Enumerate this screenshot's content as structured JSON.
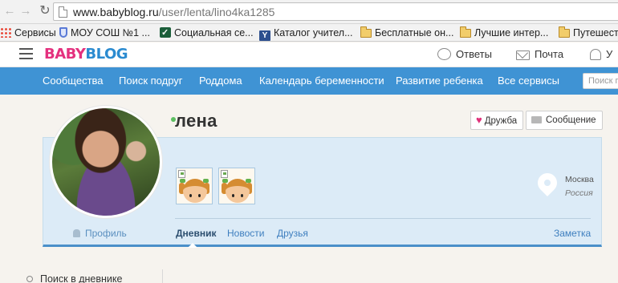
{
  "browser": {
    "url_host": "www.babyblog.ru",
    "url_path": "/user/lenta/lino4ka1285",
    "bookmarks": [
      {
        "icon": "apps-icon",
        "label": "Сервисы"
      },
      {
        "icon": "shield-icon",
        "label": "МОУ СОШ №1 ..."
      },
      {
        "icon": "check-icon",
        "label": "Социальная се..."
      },
      {
        "icon": "yandex-icon",
        "label": "Каталог учител..."
      },
      {
        "icon": "folder-icon",
        "label": "Бесплатные он..."
      },
      {
        "icon": "folder-icon",
        "label": "Лучшие интер..."
      },
      {
        "icon": "folder-icon",
        "label": "Путешест"
      }
    ]
  },
  "header": {
    "logo_baby": "BABY",
    "logo_blog": "BLOG",
    "answers": "Ответы",
    "mail": "Почта",
    "notifications_partial": "У"
  },
  "nav": {
    "items": [
      "Сообщества",
      "Поиск подруг",
      "Роддома",
      "Календарь беременности",
      "Развитие ребенка",
      "Все сервисы"
    ],
    "search_placeholder": "Поиск п"
  },
  "profile": {
    "name": "лена",
    "friend_button": "Дружба",
    "message_button": "Сообщение",
    "city": "Москва",
    "country": "Россия",
    "profile_link": "Профиль",
    "tabs": [
      "Дневник",
      "Новости",
      "Друзья"
    ],
    "active_tab": "Дневник",
    "note_link": "Заметка",
    "status": "online"
  },
  "sidebar": {
    "search_label": "Поиск в дневнике"
  },
  "colors": {
    "nav_blue": "#3f93d4",
    "card_bg": "#dcebf7",
    "logo_pink": "#e4317e",
    "logo_blue": "#2b8bd0",
    "online_green": "#5cbf61"
  }
}
